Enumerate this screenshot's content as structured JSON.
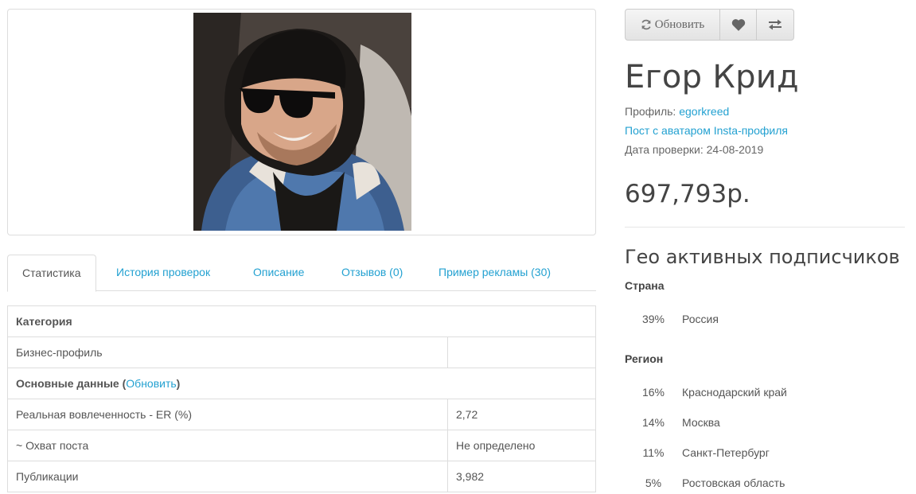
{
  "refresh_label": "Обновить",
  "name": "Егор Крид",
  "profile": {
    "label": "Профиль:",
    "handle": "egorkreed",
    "post_link": "Пост с аватаром Insta-профиля",
    "check_date": "Дата проверки: 24-08-2019"
  },
  "price": "697,793р.",
  "tabs": [
    "Статистика",
    "История проверок",
    "Описание",
    "Отзывов (0)",
    "Пример рекламы (30)"
  ],
  "table": {
    "category_header": "Категория",
    "business_profile": "Бизнес-профиль",
    "business_profile_value": "",
    "main_data_header": "Основные данные",
    "main_data_link": "Обновить",
    "rows": [
      {
        "label": "Реальная вовлеченность - ER (%)",
        "value": "2,72"
      },
      {
        "label": "~ Охват поста",
        "value": "Не определено"
      },
      {
        "label": "Публикации",
        "value": "3,982"
      }
    ]
  },
  "geo": {
    "title": "Гео активных подписчиков",
    "country_label": "Страна",
    "countries": [
      {
        "pct": "39%",
        "name": "Россия"
      }
    ],
    "region_label": "Регион",
    "regions": [
      {
        "pct": "16%",
        "name": "Краснодарский край"
      },
      {
        "pct": "14%",
        "name": "Москва"
      },
      {
        "pct": "11%",
        "name": "Санкт-Петербург"
      },
      {
        "pct": "5%",
        "name": "Ростовская область"
      }
    ]
  },
  "icons": {
    "refresh": "refresh-icon",
    "heart": "heart-icon",
    "compare": "compare-arrows-icon"
  },
  "colors": {
    "link": "#23a1d1",
    "text": "#555555",
    "border": "#dddddd"
  }
}
